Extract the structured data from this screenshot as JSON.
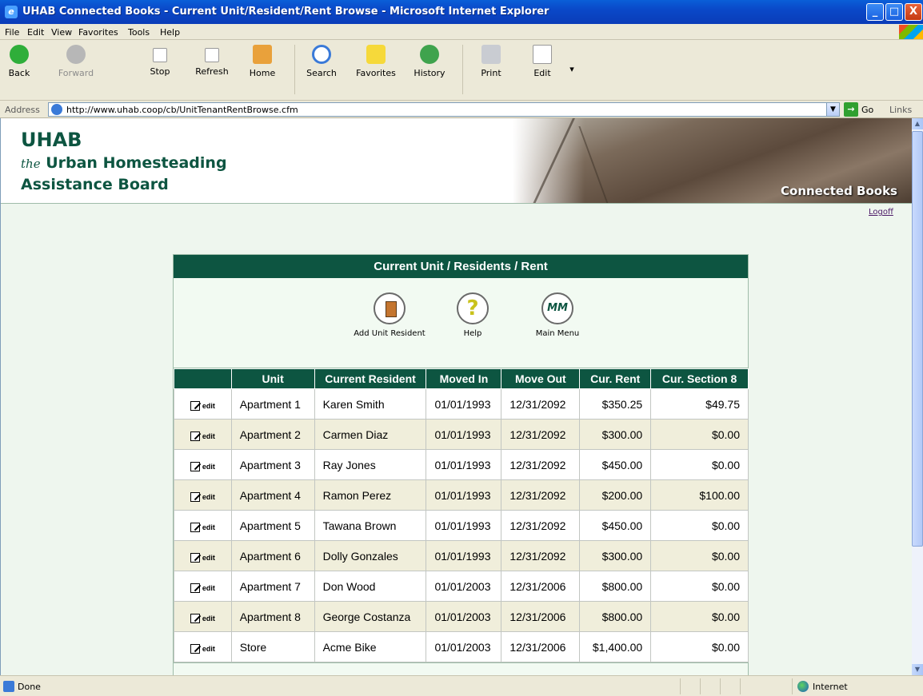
{
  "window": {
    "title": "UHAB Connected Books - Current Unit/Resident/Rent Browse - Microsoft Internet Explorer",
    "minimize": "_",
    "maximize": "□",
    "close": "X"
  },
  "menu": [
    "File",
    "Edit",
    "View",
    "Favorites",
    "Tools",
    "Help"
  ],
  "toolbar": {
    "back": "Back",
    "forward": "Forward",
    "stop": "Stop",
    "refresh": "Refresh",
    "home": "Home",
    "search": "Search",
    "favorites": "Favorites",
    "history": "History",
    "print": "Print",
    "edit": "Edit"
  },
  "address": {
    "label": "Address",
    "url": "http://www.uhab.coop/cb/UnitTenantRentBrowse.cfm",
    "go": "Go",
    "links": "Links"
  },
  "header": {
    "org_short": "UHAB",
    "org_line1_prefix": "the",
    "org_line1": "Urban Homesteading",
    "org_line2": "Assistance Board",
    "product": "Connected Books"
  },
  "logoff": "Logoff",
  "panel": {
    "title": "Current Unit / Residents / Rent",
    "actions": [
      {
        "label": "Add Unit Resident",
        "icon": "person-door-icon"
      },
      {
        "label": "Help",
        "icon": "question-icon",
        "glyph": "?"
      },
      {
        "label": "Main Menu",
        "icon": "mm-icon",
        "glyph": "MM"
      }
    ]
  },
  "table": {
    "columns": [
      "",
      "Unit",
      "Current Resident",
      "Moved In",
      "Move Out",
      "Cur. Rent",
      "Cur. Section 8"
    ],
    "edit_label": "edit",
    "rows": [
      {
        "unit": "Apartment 1",
        "resident": "Karen Smith",
        "moved_in": "01/01/1993",
        "move_out": "12/31/2092",
        "rent": "$350.25",
        "section8": "$49.75"
      },
      {
        "unit": "Apartment 2",
        "resident": "Carmen Diaz",
        "moved_in": "01/01/1993",
        "move_out": "12/31/2092",
        "rent": "$300.00",
        "section8": "$0.00"
      },
      {
        "unit": "Apartment 3",
        "resident": "Ray Jones",
        "moved_in": "01/01/1993",
        "move_out": "12/31/2092",
        "rent": "$450.00",
        "section8": "$0.00"
      },
      {
        "unit": "Apartment 4",
        "resident": "Ramon Perez",
        "moved_in": "01/01/1993",
        "move_out": "12/31/2092",
        "rent": "$200.00",
        "section8": "$100.00"
      },
      {
        "unit": "Apartment 5",
        "resident": "Tawana Brown",
        "moved_in": "01/01/1993",
        "move_out": "12/31/2092",
        "rent": "$450.00",
        "section8": "$0.00"
      },
      {
        "unit": "Apartment 6",
        "resident": "Dolly Gonzales",
        "moved_in": "01/01/1993",
        "move_out": "12/31/2092",
        "rent": "$300.00",
        "section8": "$0.00"
      },
      {
        "unit": "Apartment 7",
        "resident": "Don Wood",
        "moved_in": "01/01/2003",
        "move_out": "12/31/2006",
        "rent": "$800.00",
        "section8": "$0.00"
      },
      {
        "unit": "Apartment 8",
        "resident": "George Costanza",
        "moved_in": "01/01/2003",
        "move_out": "12/31/2006",
        "rent": "$800.00",
        "section8": "$0.00"
      },
      {
        "unit": "Store",
        "resident": "Acme Bike",
        "moved_in": "01/01/2003",
        "move_out": "12/31/2006",
        "rent": "$1,400.00",
        "section8": "$0.00"
      }
    ]
  },
  "status": {
    "text": "Done",
    "zone": "Internet"
  }
}
